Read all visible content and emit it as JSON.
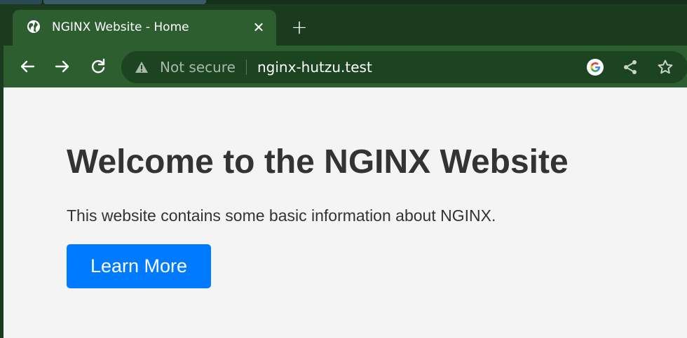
{
  "browser": {
    "tab": {
      "title": "NGINX Website - Home",
      "favicon": "globe-icon",
      "close": "✕"
    },
    "new_tab": "+",
    "nav": {
      "back": "arrow-left-icon",
      "forward": "arrow-right-icon",
      "reload": "reload-icon"
    },
    "omnibox": {
      "security_label": "Not secure",
      "url": "nginx-hutzu.test",
      "icons": [
        "warning-icon",
        "google-icon",
        "share-icon",
        "star-icon"
      ]
    },
    "colors": {
      "frame": "#1b3b1f",
      "toolbar": "#2c5e30",
      "omnibox": "#1c4420"
    }
  },
  "page": {
    "heading": "Welcome to the NGINX Website",
    "description": "This website contains some basic information about NGINX.",
    "button_label": "Learn More",
    "colors": {
      "background": "#f4f4f4",
      "text": "#333333",
      "button": "#007bff"
    }
  }
}
